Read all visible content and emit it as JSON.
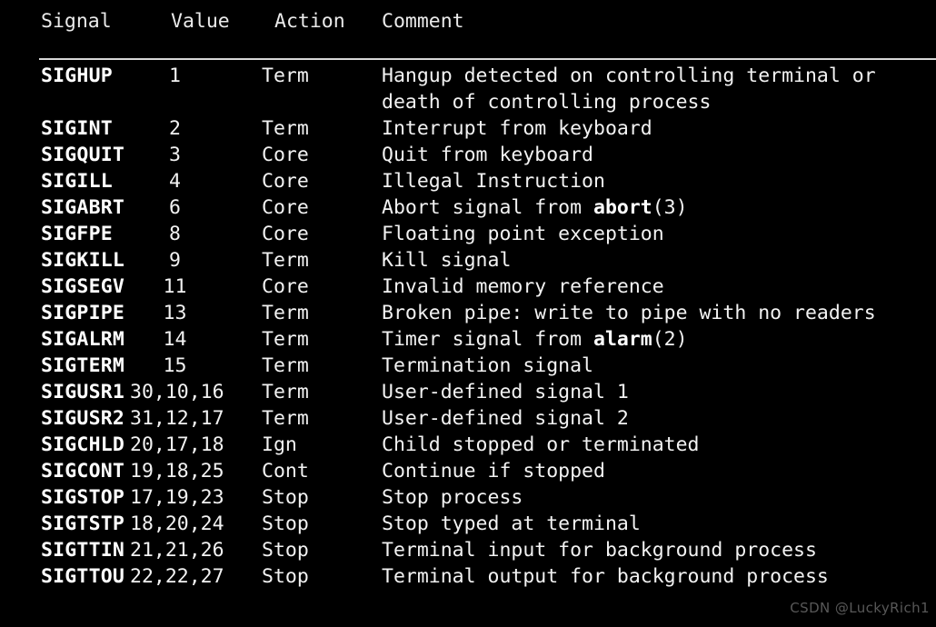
{
  "table": {
    "columns": [
      {
        "key": "signal",
        "label": "Signal"
      },
      {
        "key": "value",
        "label": "Value"
      },
      {
        "key": "action",
        "label": "Action"
      },
      {
        "key": "comment",
        "label": "Comment"
      }
    ],
    "rows": [
      {
        "signal": "SIGHUP",
        "value": "1",
        "action": "Term",
        "comment": "Hangup detected on controlling terminal or death of controlling process"
      },
      {
        "signal": "SIGINT",
        "value": "2",
        "action": "Term",
        "comment": "Interrupt from keyboard"
      },
      {
        "signal": "SIGQUIT",
        "value": "3",
        "action": "Core",
        "comment": "Quit from keyboard"
      },
      {
        "signal": "SIGILL",
        "value": "4",
        "action": "Core",
        "comment": "Illegal Instruction"
      },
      {
        "signal": "SIGABRT",
        "value": "6",
        "action": "Core",
        "comment": "Abort signal from abort(3)",
        "comment_bold": "abort"
      },
      {
        "signal": "SIGFPE",
        "value": "8",
        "action": "Core",
        "comment": "Floating point exception"
      },
      {
        "signal": "SIGKILL",
        "value": "9",
        "action": "Term",
        "comment": "Kill signal"
      },
      {
        "signal": "SIGSEGV",
        "value": "11",
        "action": "Core",
        "comment": "Invalid memory reference"
      },
      {
        "signal": "SIGPIPE",
        "value": "13",
        "action": "Term",
        "comment": "Broken pipe: write to pipe with no readers"
      },
      {
        "signal": "SIGALRM",
        "value": "14",
        "action": "Term",
        "comment": "Timer signal from alarm(2)",
        "comment_bold": "alarm"
      },
      {
        "signal": "SIGTERM",
        "value": "15",
        "action": "Term",
        "comment": "Termination signal"
      },
      {
        "signal": "SIGUSR1",
        "value": "30,10,16",
        "action": "Term",
        "comment": "User-defined signal 1"
      },
      {
        "signal": "SIGUSR2",
        "value": "31,12,17",
        "action": "Term",
        "comment": "User-defined signal 2"
      },
      {
        "signal": "SIGCHLD",
        "value": "20,17,18",
        "action": "Ign",
        "comment": "Child stopped or terminated"
      },
      {
        "signal": "SIGCONT",
        "value": "19,18,25",
        "action": "Cont",
        "comment": "Continue if stopped"
      },
      {
        "signal": "SIGSTOP",
        "value": "17,19,23",
        "action": "Stop",
        "comment": "Stop process"
      },
      {
        "signal": "SIGTSTP",
        "value": "18,20,24",
        "action": "Stop",
        "comment": "Stop typed at terminal"
      },
      {
        "signal": "SIGTTIN",
        "value": "21,21,26",
        "action": "Stop",
        "comment": "Terminal input for background process"
      },
      {
        "signal": "SIGTTOU",
        "value": "22,22,27",
        "action": "Stop",
        "comment": "Terminal output for background process"
      }
    ]
  },
  "watermark": {
    "text": "CSDN @LuckyRich1"
  },
  "colors": {
    "background": "#000000",
    "text": "#f2f2f2",
    "bold_text": "#ffffff",
    "rule": "#d8d8d8",
    "watermark": "#d0d0d0"
  }
}
